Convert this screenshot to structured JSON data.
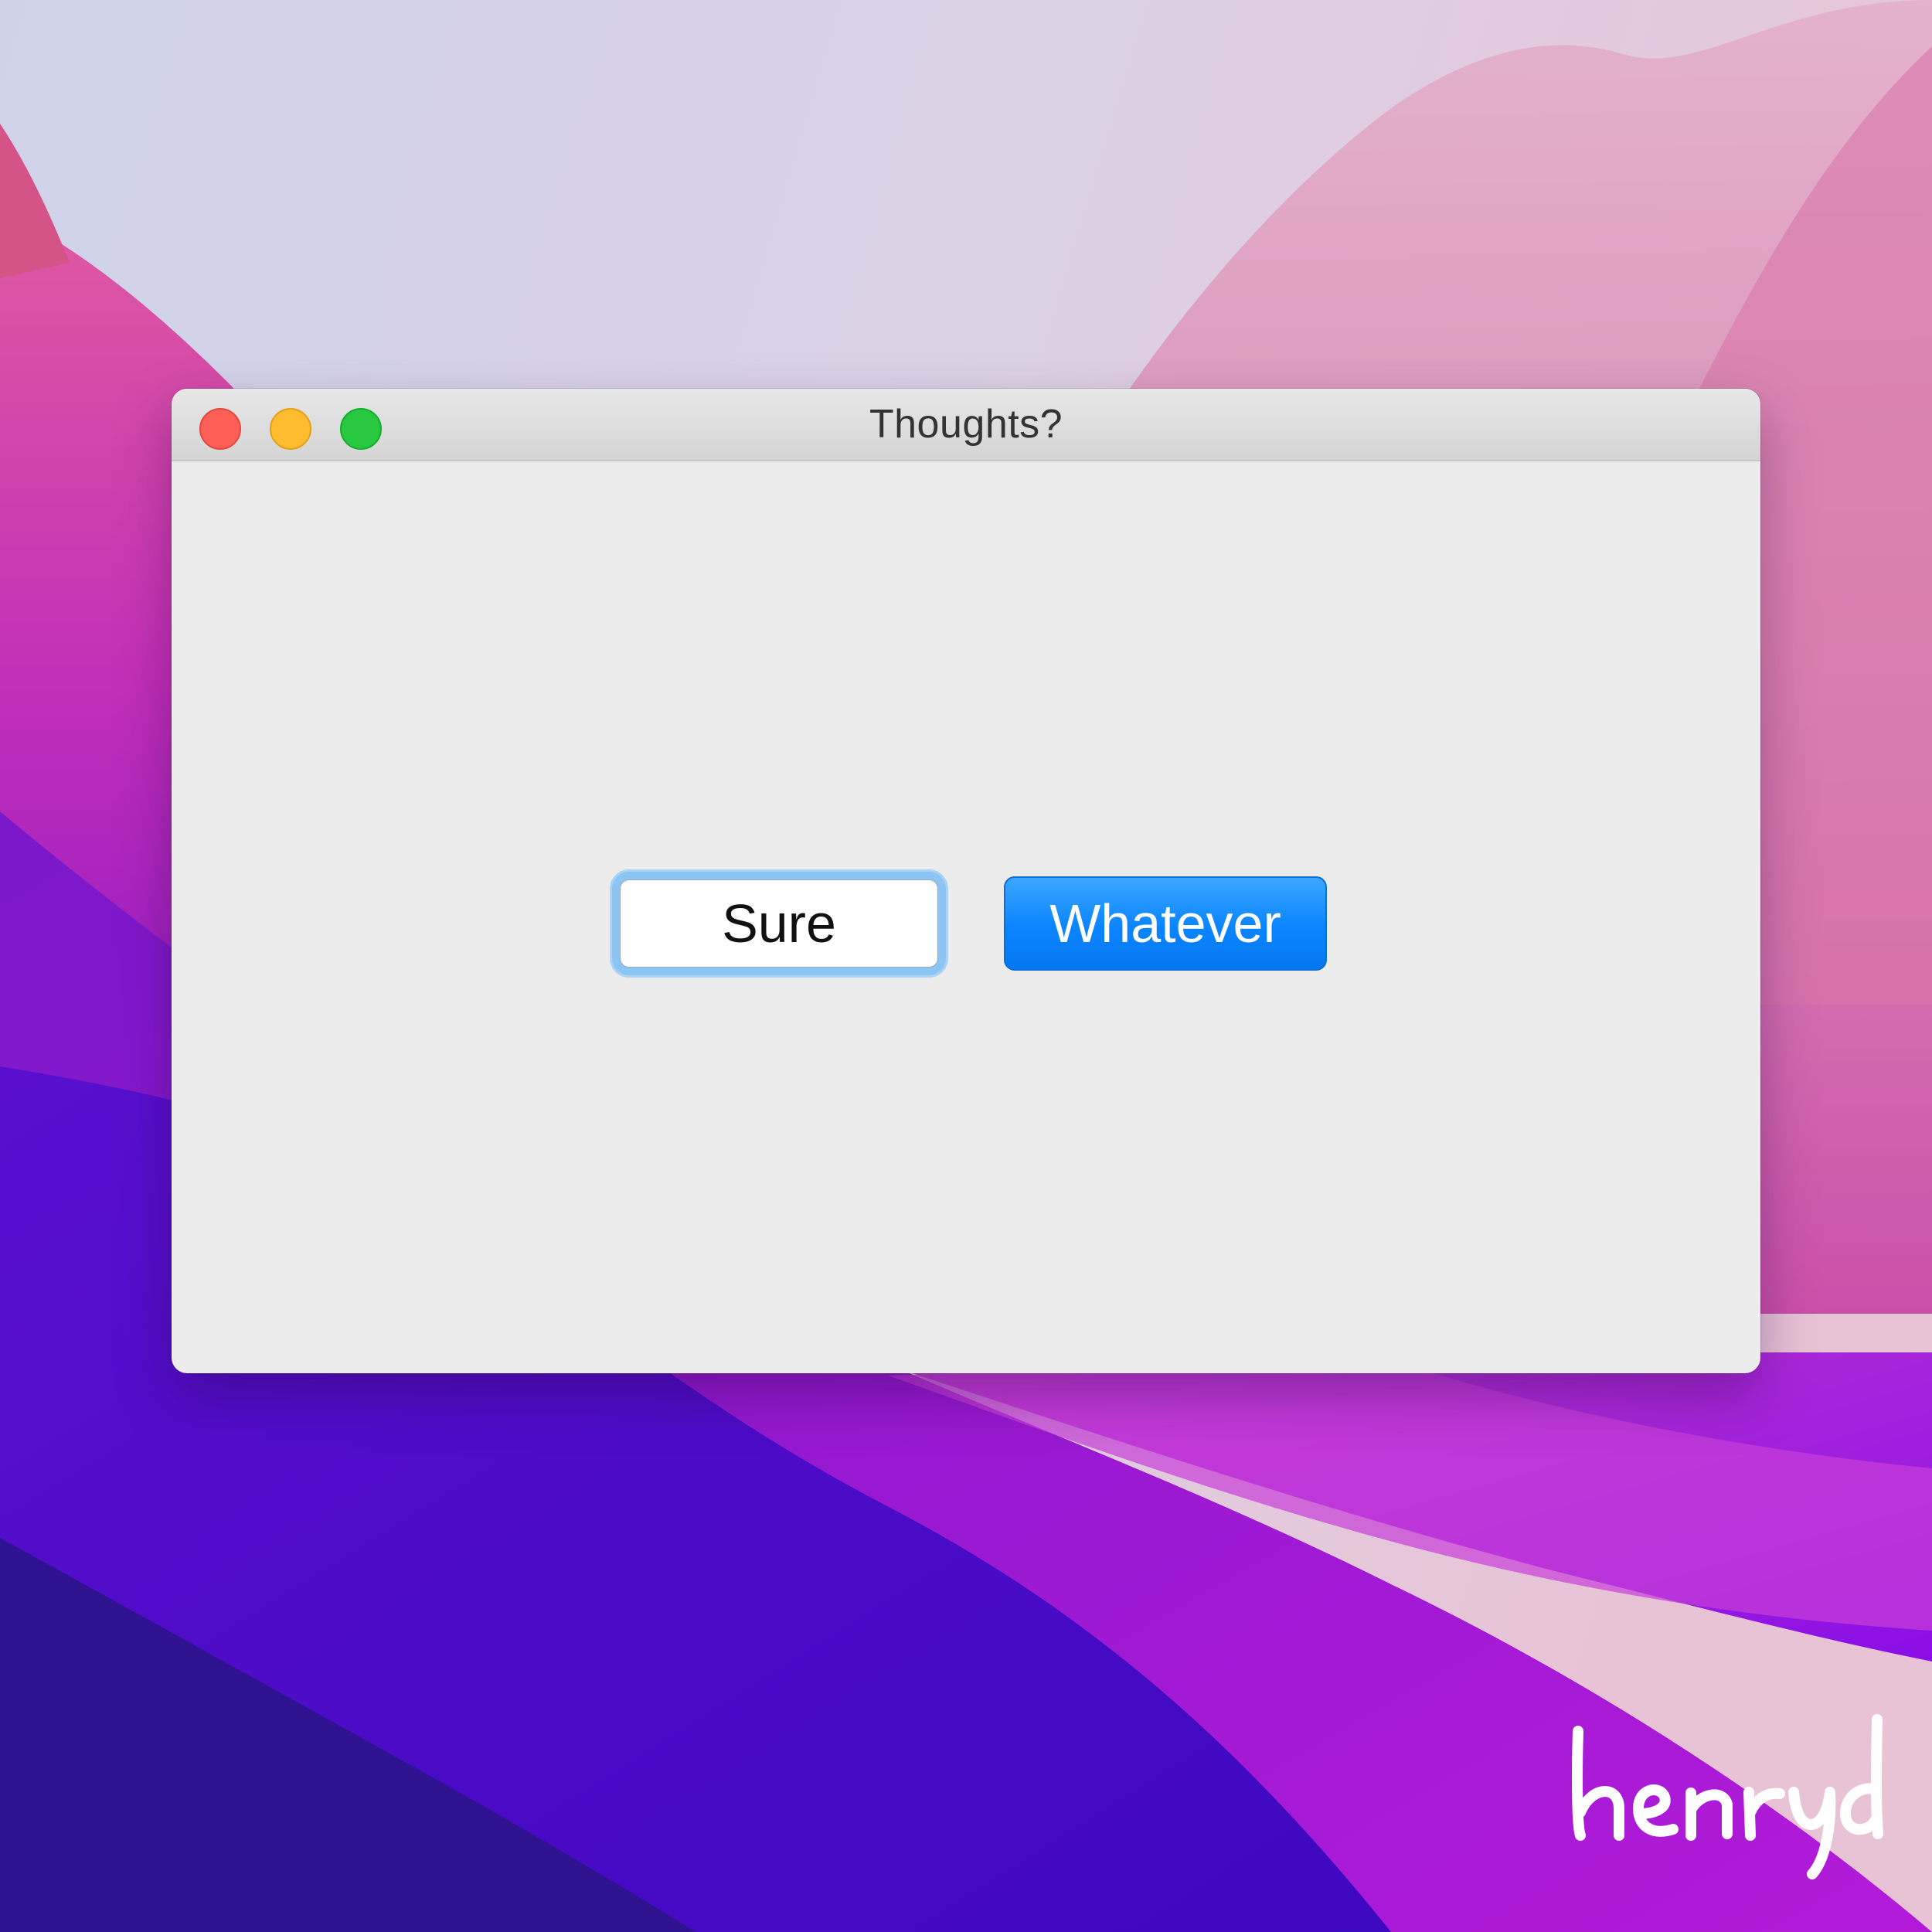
{
  "window": {
    "title": "Thoughts?",
    "controls": [
      "close",
      "minimize",
      "zoom"
    ]
  },
  "dialog": {
    "buttons": [
      {
        "label": "Sure",
        "focused": true
      },
      {
        "label": "Whatever",
        "default": true
      }
    ]
  },
  "signature": {
    "text": "henryd",
    "color": "#ffffff"
  },
  "colors": {
    "traffic_close": "#ff5f57",
    "traffic_minimize": "#febc2e",
    "traffic_zoom": "#28c840",
    "default_button": "#0a84ff",
    "focus_ring": "#8cc4f3",
    "window_background": "#ececec"
  }
}
